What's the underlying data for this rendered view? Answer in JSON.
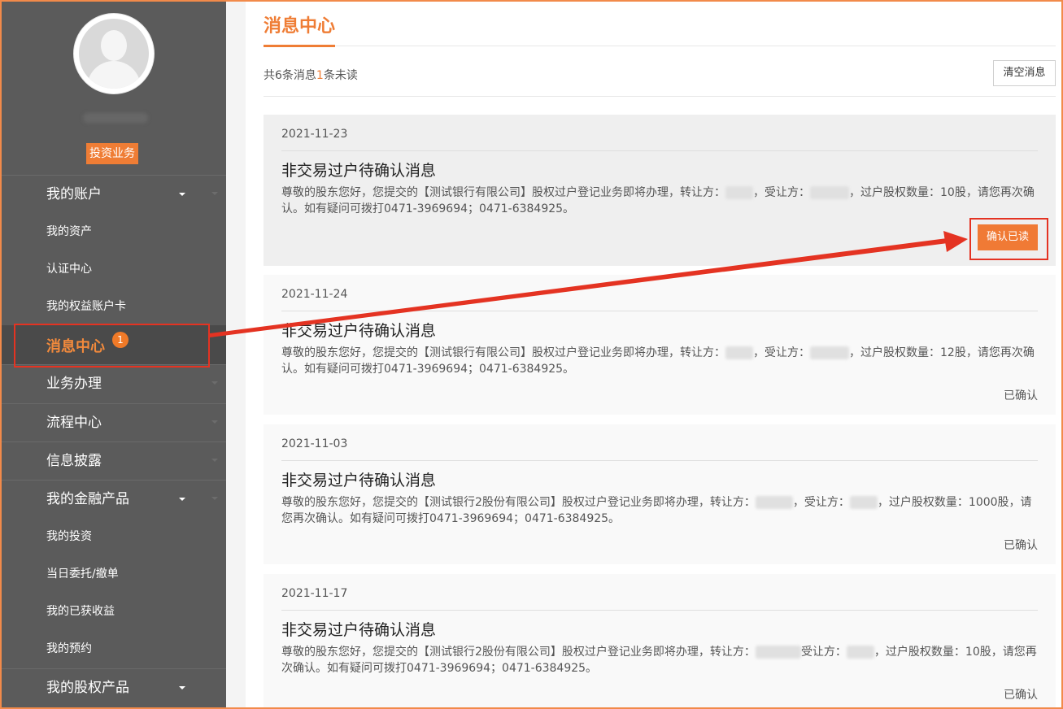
{
  "sidebar": {
    "role_badge": "投资业务",
    "items": [
      {
        "label": "我的账户",
        "sub": [
          "我的资产",
          "认证中心",
          "我的权益账户卡"
        ]
      },
      {
        "label": "消息中心",
        "badge": "1",
        "active": true
      },
      {
        "label": "业务办理"
      },
      {
        "label": "流程中心"
      },
      {
        "label": "信息披露"
      },
      {
        "label": "我的金融产品",
        "sub": [
          "我的投资",
          "当日委托/撤单",
          "我的已获收益",
          "我的预约"
        ]
      },
      {
        "label": "我的股权产品"
      }
    ]
  },
  "main": {
    "title": "消息中心",
    "summary": {
      "prefix": "共6条消息",
      "unread": "1",
      "suffix": "条未读"
    },
    "clear_label": "清空消息",
    "messages": [
      {
        "date": "2021-11-23",
        "title": "非交易过户待确认消息",
        "p1": "尊敬的股东您好，您提交的【测试银行有限公司】股权过户登记业务即将办理，转让方：",
        "p2": "，受让方：",
        "p3": "，过户股权数量：10股，请您再次确认。如有疑问可拨打0471-3969694；0471-6384925。",
        "action": "确认已读"
      },
      {
        "date": "2021-11-24",
        "title": "非交易过户待确认消息",
        "p1": "尊敬的股东您好，您提交的【测试银行有限公司】股权过户登记业务即将办理，转让方：",
        "p2": "，受让方：",
        "p3": "，过户股权数量：12股，请您再次确认。如有疑问可拨打0471-3969694；0471-6384925。",
        "status": "已确认"
      },
      {
        "date": "2021-11-03",
        "title": "非交易过户待确认消息",
        "p1": "尊敬的股东您好，您提交的【测试银行2股份有限公司】股权过户登记业务即将办理，转让方：",
        "p2": "，受让方：",
        "p3": "，过户股权数量：1000股，请您再次确认。如有疑问可拨打0471-3969694；0471-6384925。",
        "status": "已确认"
      },
      {
        "date": "2021-11-17",
        "title": "非交易过户待确认消息",
        "p1": "尊敬的股东您好，您提交的【测试银行2股份有限公司】股权过户登记业务即将办理，转让方：",
        "p2": "受让方：",
        "p3": "，过户股权数量：10股，请您再次确认。如有疑问可拨打0471-3969694；0471-6384925。",
        "status": "已确认"
      }
    ]
  },
  "colors": {
    "accent": "#ef7d35",
    "annotation": "#e43322",
    "sidebar": "#5b5b5b"
  }
}
